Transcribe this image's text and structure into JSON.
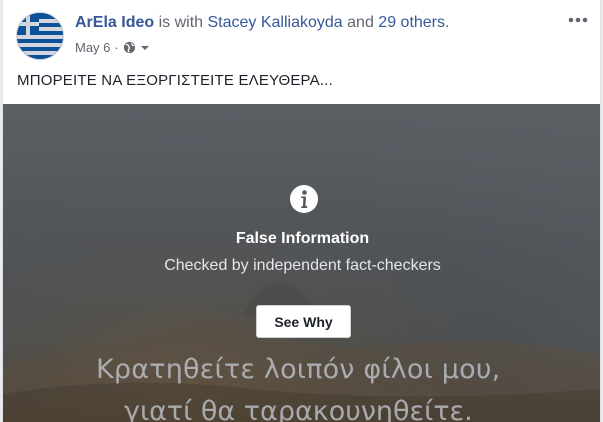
{
  "post": {
    "author": "ArEla Ideo",
    "with_text": "is with",
    "tagged_person": "Stacey Kalliakoyda",
    "and_text": "and",
    "others": "29 others",
    "period": ".",
    "date": "May 6",
    "separator": "·",
    "audience_icon": "globe-icon",
    "text": "ΜΠΟΡΕΙΤΕ ΝΑ ΕΞΟΡΓΙΣΤΕΙΤΕ ΕΛΕΥΘΕΡΑ..."
  },
  "overlay": {
    "icon": "info-icon",
    "title": "False Information",
    "subtitle": "Checked by independent fact-checkers",
    "button": "See Why"
  },
  "image_caption": {
    "line1": "Κρατηθείτε λοιπόν φίλοι μου,",
    "line2": "γιατί θα ταρακουνηθείτε."
  },
  "colors": {
    "link": "#365899",
    "text": "#1d2129",
    "secondary": "#606770"
  }
}
